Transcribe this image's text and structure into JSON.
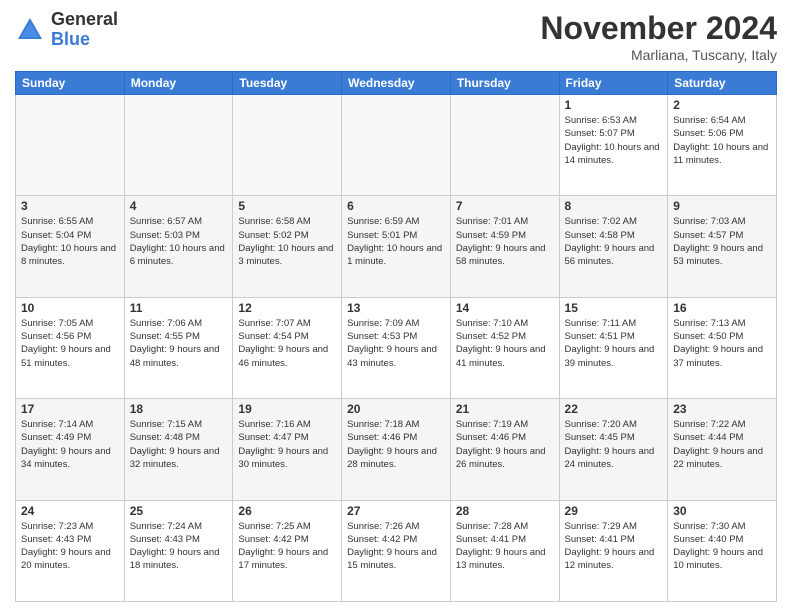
{
  "header": {
    "logo_general": "General",
    "logo_blue": "Blue",
    "month_title": "November 2024",
    "location": "Marliana, Tuscany, Italy"
  },
  "days_of_week": [
    "Sunday",
    "Monday",
    "Tuesday",
    "Wednesday",
    "Thursday",
    "Friday",
    "Saturday"
  ],
  "weeks": [
    [
      {
        "day": "",
        "info": ""
      },
      {
        "day": "",
        "info": ""
      },
      {
        "day": "",
        "info": ""
      },
      {
        "day": "",
        "info": ""
      },
      {
        "day": "",
        "info": ""
      },
      {
        "day": "1",
        "info": "Sunrise: 6:53 AM\nSunset: 5:07 PM\nDaylight: 10 hours and 14 minutes."
      },
      {
        "day": "2",
        "info": "Sunrise: 6:54 AM\nSunset: 5:06 PM\nDaylight: 10 hours and 11 minutes."
      }
    ],
    [
      {
        "day": "3",
        "info": "Sunrise: 6:55 AM\nSunset: 5:04 PM\nDaylight: 10 hours and 8 minutes."
      },
      {
        "day": "4",
        "info": "Sunrise: 6:57 AM\nSunset: 5:03 PM\nDaylight: 10 hours and 6 minutes."
      },
      {
        "day": "5",
        "info": "Sunrise: 6:58 AM\nSunset: 5:02 PM\nDaylight: 10 hours and 3 minutes."
      },
      {
        "day": "6",
        "info": "Sunrise: 6:59 AM\nSunset: 5:01 PM\nDaylight: 10 hours and 1 minute."
      },
      {
        "day": "7",
        "info": "Sunrise: 7:01 AM\nSunset: 4:59 PM\nDaylight: 9 hours and 58 minutes."
      },
      {
        "day": "8",
        "info": "Sunrise: 7:02 AM\nSunset: 4:58 PM\nDaylight: 9 hours and 56 minutes."
      },
      {
        "day": "9",
        "info": "Sunrise: 7:03 AM\nSunset: 4:57 PM\nDaylight: 9 hours and 53 minutes."
      }
    ],
    [
      {
        "day": "10",
        "info": "Sunrise: 7:05 AM\nSunset: 4:56 PM\nDaylight: 9 hours and 51 minutes."
      },
      {
        "day": "11",
        "info": "Sunrise: 7:06 AM\nSunset: 4:55 PM\nDaylight: 9 hours and 48 minutes."
      },
      {
        "day": "12",
        "info": "Sunrise: 7:07 AM\nSunset: 4:54 PM\nDaylight: 9 hours and 46 minutes."
      },
      {
        "day": "13",
        "info": "Sunrise: 7:09 AM\nSunset: 4:53 PM\nDaylight: 9 hours and 43 minutes."
      },
      {
        "day": "14",
        "info": "Sunrise: 7:10 AM\nSunset: 4:52 PM\nDaylight: 9 hours and 41 minutes."
      },
      {
        "day": "15",
        "info": "Sunrise: 7:11 AM\nSunset: 4:51 PM\nDaylight: 9 hours and 39 minutes."
      },
      {
        "day": "16",
        "info": "Sunrise: 7:13 AM\nSunset: 4:50 PM\nDaylight: 9 hours and 37 minutes."
      }
    ],
    [
      {
        "day": "17",
        "info": "Sunrise: 7:14 AM\nSunset: 4:49 PM\nDaylight: 9 hours and 34 minutes."
      },
      {
        "day": "18",
        "info": "Sunrise: 7:15 AM\nSunset: 4:48 PM\nDaylight: 9 hours and 32 minutes."
      },
      {
        "day": "19",
        "info": "Sunrise: 7:16 AM\nSunset: 4:47 PM\nDaylight: 9 hours and 30 minutes."
      },
      {
        "day": "20",
        "info": "Sunrise: 7:18 AM\nSunset: 4:46 PM\nDaylight: 9 hours and 28 minutes."
      },
      {
        "day": "21",
        "info": "Sunrise: 7:19 AM\nSunset: 4:46 PM\nDaylight: 9 hours and 26 minutes."
      },
      {
        "day": "22",
        "info": "Sunrise: 7:20 AM\nSunset: 4:45 PM\nDaylight: 9 hours and 24 minutes."
      },
      {
        "day": "23",
        "info": "Sunrise: 7:22 AM\nSunset: 4:44 PM\nDaylight: 9 hours and 22 minutes."
      }
    ],
    [
      {
        "day": "24",
        "info": "Sunrise: 7:23 AM\nSunset: 4:43 PM\nDaylight: 9 hours and 20 minutes."
      },
      {
        "day": "25",
        "info": "Sunrise: 7:24 AM\nSunset: 4:43 PM\nDaylight: 9 hours and 18 minutes."
      },
      {
        "day": "26",
        "info": "Sunrise: 7:25 AM\nSunset: 4:42 PM\nDaylight: 9 hours and 17 minutes."
      },
      {
        "day": "27",
        "info": "Sunrise: 7:26 AM\nSunset: 4:42 PM\nDaylight: 9 hours and 15 minutes."
      },
      {
        "day": "28",
        "info": "Sunrise: 7:28 AM\nSunset: 4:41 PM\nDaylight: 9 hours and 13 minutes."
      },
      {
        "day": "29",
        "info": "Sunrise: 7:29 AM\nSunset: 4:41 PM\nDaylight: 9 hours and 12 minutes."
      },
      {
        "day": "30",
        "info": "Sunrise: 7:30 AM\nSunset: 4:40 PM\nDaylight: 9 hours and 10 minutes."
      }
    ]
  ]
}
